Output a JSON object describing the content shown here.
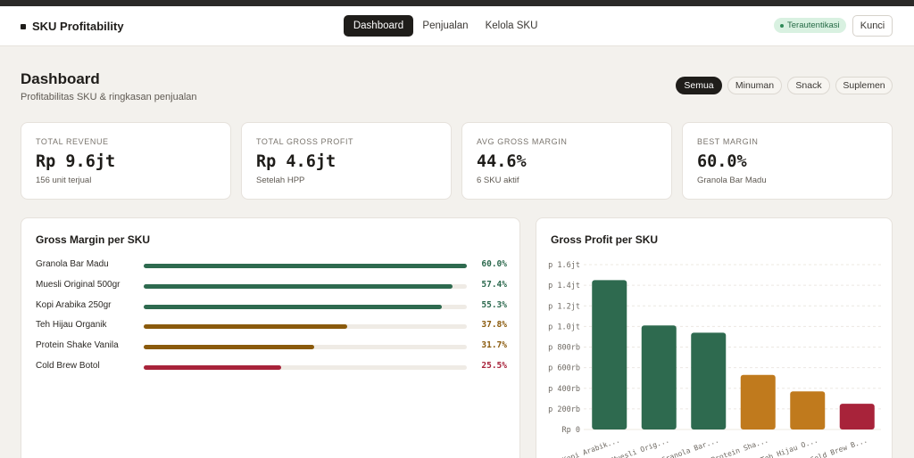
{
  "app": {
    "title": "SKU Profitability"
  },
  "nav": {
    "tabs": [
      {
        "label": "Dashboard",
        "active": true
      },
      {
        "label": "Penjualan",
        "active": false
      },
      {
        "label": "Kelola SKU",
        "active": false
      }
    ],
    "auth_badge": "Terautentikasi",
    "lock_label": "Kunci"
  },
  "page": {
    "title": "Dashboard",
    "subtitle": "Profitabilitas SKU & ringkasan penjualan"
  },
  "filters": [
    {
      "label": "Semua",
      "active": true
    },
    {
      "label": "Minuman",
      "active": false
    },
    {
      "label": "Snack",
      "active": false
    },
    {
      "label": "Suplemen",
      "active": false
    }
  ],
  "stats": [
    {
      "label": "TOTAL REVENUE",
      "value": "Rp 9.6jt",
      "sub": "156 unit terjual"
    },
    {
      "label": "TOTAL GROSS PROFIT",
      "value": "Rp 4.6jt",
      "sub": "Setelah HPP"
    },
    {
      "label": "AVG GROSS MARGIN",
      "value": "44.6%",
      "sub": "6 SKU aktif"
    },
    {
      "label": "BEST MARGIN",
      "value": "60.0%",
      "sub": "Granola Bar Madu"
    }
  ],
  "colors": {
    "green": "#2e6a4f",
    "amber": "#8a5a0c",
    "red": "#a8233a",
    "orange": "#c07a1d",
    "track": "#efebe5"
  },
  "gross_margin": {
    "title": "Gross Margin per SKU",
    "rows": [
      {
        "name": "Granola Bar Madu",
        "value": 60.0,
        "value_label": "60.0%",
        "color": "#2e6a4f"
      },
      {
        "name": "Muesli Original 500gr",
        "value": 57.4,
        "value_label": "57.4%",
        "color": "#2e6a4f"
      },
      {
        "name": "Kopi Arabika 250gr",
        "value": 55.3,
        "value_label": "55.3%",
        "color": "#2e6a4f"
      },
      {
        "name": "Teh Hijau Organik",
        "value": 37.8,
        "value_label": "37.8%",
        "color": "#8a5a0c"
      },
      {
        "name": "Protein Shake Vanila",
        "value": 31.7,
        "value_label": "31.7%",
        "color": "#8a5a0c"
      },
      {
        "name": "Cold Brew Botol",
        "value": 25.5,
        "value_label": "25.5%",
        "color": "#a8233a"
      }
    ],
    "max": 60.0
  },
  "gross_profit": {
    "title": "Gross Profit per SKU"
  },
  "chart_data": [
    {
      "type": "bar",
      "orientation": "horizontal",
      "title": "Gross Margin per SKU",
      "categories": [
        "Granola Bar Madu",
        "Muesli Original 500gr",
        "Kopi Arabika 250gr",
        "Teh Hijau Organik",
        "Protein Shake Vanila",
        "Cold Brew Botol"
      ],
      "values": [
        60.0,
        57.4,
        55.3,
        37.8,
        31.7,
        25.5
      ]
    },
    {
      "type": "bar",
      "title": "Gross Profit per SKU",
      "categories": [
        "Kopi Arabik...",
        "Muesli Orig...",
        "Granola Bar...",
        "Protein Sha...",
        "Teh Hijau O...",
        "Cold Brew B..."
      ],
      "values": [
        1450000,
        1010000,
        940000,
        530000,
        370000,
        250000
      ],
      "colors": [
        "#2e6a4f",
        "#2e6a4f",
        "#2e6a4f",
        "#c07a1d",
        "#c07a1d",
        "#a8233a"
      ],
      "ylim": [
        0,
        1600000
      ],
      "yticks": [
        0,
        200000,
        400000,
        600000,
        800000,
        1000000,
        1200000,
        1400000,
        1600000
      ],
      "ytick_labels": [
        "Rp 0",
        "p 200rb",
        "p 400rb",
        "p 600rb",
        "p 800rb",
        "p 1.0jt",
        "p 1.2jt",
        "p 1.4jt",
        "p 1.6jt"
      ],
      "grid": true
    }
  ]
}
